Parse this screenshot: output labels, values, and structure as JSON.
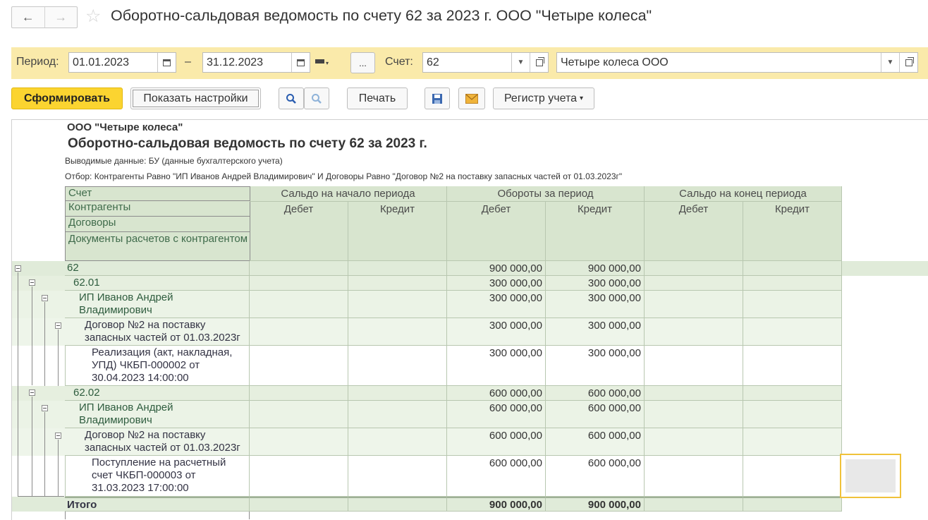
{
  "window": {
    "title": "Оборотно-сальдовая ведомость по счету 62 за 2023 г. ООО \"Четыре колеса\"",
    "back_icon": "←",
    "forward_icon": "→",
    "star_icon": "☆"
  },
  "params": {
    "period_label": "Период:",
    "date_from": "01.01.2023",
    "dash": "–",
    "date_to": "31.12.2023",
    "ellipsis": "...",
    "account_label": "Счет:",
    "account": "62",
    "organization": "Четыре колеса ООО"
  },
  "toolbar": {
    "generate": "Сформировать",
    "show_settings": "Показать настройки",
    "print": "Печать",
    "register": "Регистр учета",
    "dropdown_arrow": "▾"
  },
  "report": {
    "org": "ООО \"Четыре колеса\"",
    "title": "Оборотно-сальдовая ведомость по счету 62 за 2023 г.",
    "data_line": "Выводимые данные: БУ (данные бухгалтерского учета)",
    "filter_line": "Отбор: Контрагенты Равно \"ИП Иванов Андрей Владимирович\" И Договоры Равно \"Договор №2 на поставку запасных частей от 01.03.2023г\"",
    "header": {
      "account": "Счет",
      "counterparties": "Контрагенты",
      "contracts": "Договоры",
      "documents": "Документы расчетов с контрагентом",
      "opening": "Сальдо на начало периода",
      "turnover": "Обороты за период",
      "closing": "Сальдо на конец периода",
      "debit": "Дебет",
      "credit": "Кредит"
    },
    "rows": [
      {
        "label": "62",
        "td": "900 000,00",
        "tc": "900 000,00"
      },
      {
        "label": "62.01",
        "td": "300 000,00",
        "tc": "300 000,00"
      },
      {
        "label": "ИП Иванов Андрей Владимирович",
        "td": "300 000,00",
        "tc": "300 000,00"
      },
      {
        "label": "Договор №2 на поставку запасных частей от 01.03.2023г",
        "td": "300 000,00",
        "tc": "300 000,00"
      },
      {
        "label": "Реализация (акт, накладная, УПД) ЧКБП-000002 от 30.04.2023 14:00:00",
        "td": "300 000,00",
        "tc": "300 000,00"
      },
      {
        "label": "62.02",
        "td": "600 000,00",
        "tc": "600 000,00"
      },
      {
        "label": "ИП Иванов Андрей Владимирович",
        "td": "600 000,00",
        "tc": "600 000,00"
      },
      {
        "label": "Договор №2 на поставку запасных частей от 01.03.2023г",
        "td": "600 000,00",
        "tc": "600 000,00"
      },
      {
        "label": "Поступление на расчетный счет ЧКБП-000003 от 31.03.2023 17:00:00",
        "td": "600 000,00",
        "tc": "600 000,00"
      }
    ],
    "total": {
      "label": "Итого",
      "td": "900 000,00",
      "tc": "900 000,00"
    }
  }
}
